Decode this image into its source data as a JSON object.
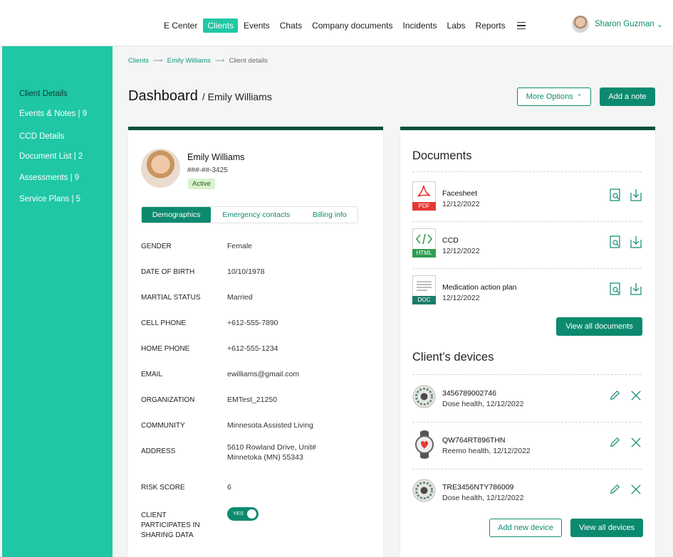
{
  "nav": {
    "items": [
      "E Center",
      "Clients",
      "Events",
      "Chats",
      "Company documents",
      "Incidents",
      "Labs",
      "Reports"
    ],
    "active": "Clients",
    "menu_icon": "hamburger-icon"
  },
  "user": {
    "name": "Sharon Guzman",
    "caret": "⌄"
  },
  "sidebar": {
    "items": [
      {
        "label": "Client Details"
      },
      {
        "label": "Events & Notes | 9"
      },
      {
        "label": "CCD Details"
      },
      {
        "label": "Document List | 2"
      },
      {
        "label": "Assessments | 9"
      },
      {
        "label": "Service Plans | 5"
      }
    ]
  },
  "breadcrumb": {
    "items": [
      "Clients",
      "Emily Williams",
      "Client details"
    ],
    "separator": "⟶"
  },
  "header": {
    "title": "Dashboard",
    "subtitle": "/ Emily Williams",
    "more_options": "More Options",
    "add_note": "Add a note"
  },
  "profile": {
    "name": "Emily Williams",
    "ssn": "###-##-3425",
    "status": "Active",
    "tabs": [
      "Demographics",
      "Emergency contacts",
      "Billing info"
    ],
    "fields": [
      {
        "label": "GENDER",
        "value": "Female"
      },
      {
        "label": "DATE OF BIRTH",
        "value": "10/10/1978"
      },
      {
        "label": "MARTIAL STATUS",
        "value": "Married"
      },
      {
        "label": "CELL PHONE",
        "value": "+612-555-7890"
      },
      {
        "label": "HOME PHONE",
        "value": "+612-555-1234"
      },
      {
        "label": "EMAIL",
        "value": "ewilliams@gmail.com"
      },
      {
        "label": "ORGANIZATION",
        "value": "EMTest_21250"
      },
      {
        "label": "COMMUNITY",
        "value": "Minnesota Assisted Living"
      },
      {
        "label": "ADDRESS",
        "value": "5610 Rowland Drive, Unit#",
        "value2": "Minnetoka (MN) 55343"
      },
      {
        "label": "RISK SCORE",
        "value": "6"
      }
    ],
    "sharing": {
      "label": [
        "CLIENT",
        "PARTICIPATES IN",
        "SHARING DATA"
      ],
      "toggle": "YES"
    }
  },
  "documents": {
    "title": "Documents",
    "items": [
      {
        "name": "Facesheet",
        "date": "12/12/2022",
        "type": "PDF",
        "color": "#e53935"
      },
      {
        "name": "CCD",
        "date": "12/12/2022",
        "type": "HTML",
        "color": "#2e9e4f"
      },
      {
        "name": "Medication action plan",
        "date": "12/12/2022",
        "type": "DOC",
        "color": "#1b7d6a"
      }
    ],
    "view_all": "View all documents"
  },
  "devices": {
    "title": "Client’s devices",
    "items": [
      {
        "id": "3456789002746",
        "sub": "Dose health, 12/12/2022",
        "kind": "pill-dispenser-icon"
      },
      {
        "id": "QW764RT896THN",
        "sub": "Reemo health, 12/12/2022",
        "kind": "smartwatch-icon"
      },
      {
        "id": "TRE3456NTY786009",
        "sub": "Dose health, 12/12/2022",
        "kind": "pill-dispenser-icon"
      }
    ],
    "add_new": "Add new device",
    "view_all": "View all devices"
  },
  "colors": {
    "accent": "#1fc7a5",
    "primary": "#0c8a6f",
    "dark": "#0d4f3f"
  }
}
